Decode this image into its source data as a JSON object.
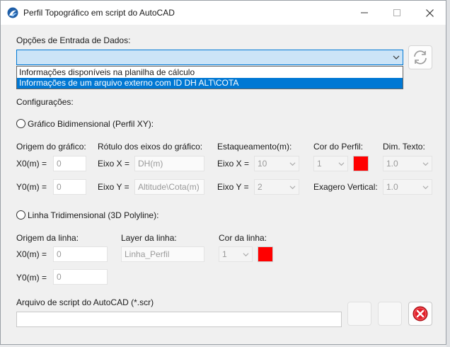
{
  "window": {
    "title": "Perfil Topográfico em script do AutoCAD"
  },
  "input_section": {
    "label": "Opções de Entrada de Dados:",
    "combo_value": "",
    "options": [
      "Informações disponíveis na planilha de cálculo",
      "Informações de um arquivo externo com ID DH ALT\\COTA"
    ],
    "highlighted_option": 1
  },
  "settings": {
    "label": "Configurações:"
  },
  "graph2d": {
    "radio_label": "Gráfico Bidimensional (Perfil XY):",
    "origin_label": "Origem do gráfico:",
    "x0_label": "X0(m) =",
    "x0_value": "0",
    "y0_label": "Y0(m) =",
    "y0_value": "0",
    "axis_label_title": "Rótulo dos eixos do gráfico:",
    "axis_x_label": "Eixo X =",
    "axis_x_value": "DH(m)",
    "axis_y_label": "Eixo Y =",
    "axis_y_value": "Altitude\\Cota(m)",
    "stake_label": "Estaqueamento(m):",
    "stake_x_label": "Eixo X =",
    "stake_x_value": "10",
    "stake_y_label": "Eixo Y =",
    "stake_y_value": "2",
    "profile_color_label": "Cor do Perfil:",
    "profile_color_value": "1",
    "profile_color": "#ff0000",
    "text_dim_label": "Dim. Texto:",
    "text_dim_value": "1.0",
    "exaggeration_label": "Exagero Vertical:",
    "exaggeration_value": "1.0"
  },
  "line3d": {
    "radio_label": "Linha Tridimensional (3D Polyline):",
    "origin_label": "Origem da linha:",
    "x0_label": "X0(m) =",
    "x0_value": "0",
    "y0_label": "Y0(m) =",
    "y0_value": "0",
    "layer_label": "Layer da linha:",
    "layer_value": "Linha_Perfil",
    "color_label": "Cor da linha:",
    "color_value": "1",
    "line_color": "#ff0000"
  },
  "script": {
    "label": "Arquivo de script do AutoCAD (*.scr)",
    "path_value": ""
  },
  "colors": {
    "accent": "#0078d4",
    "cancel": "#e0202a"
  }
}
